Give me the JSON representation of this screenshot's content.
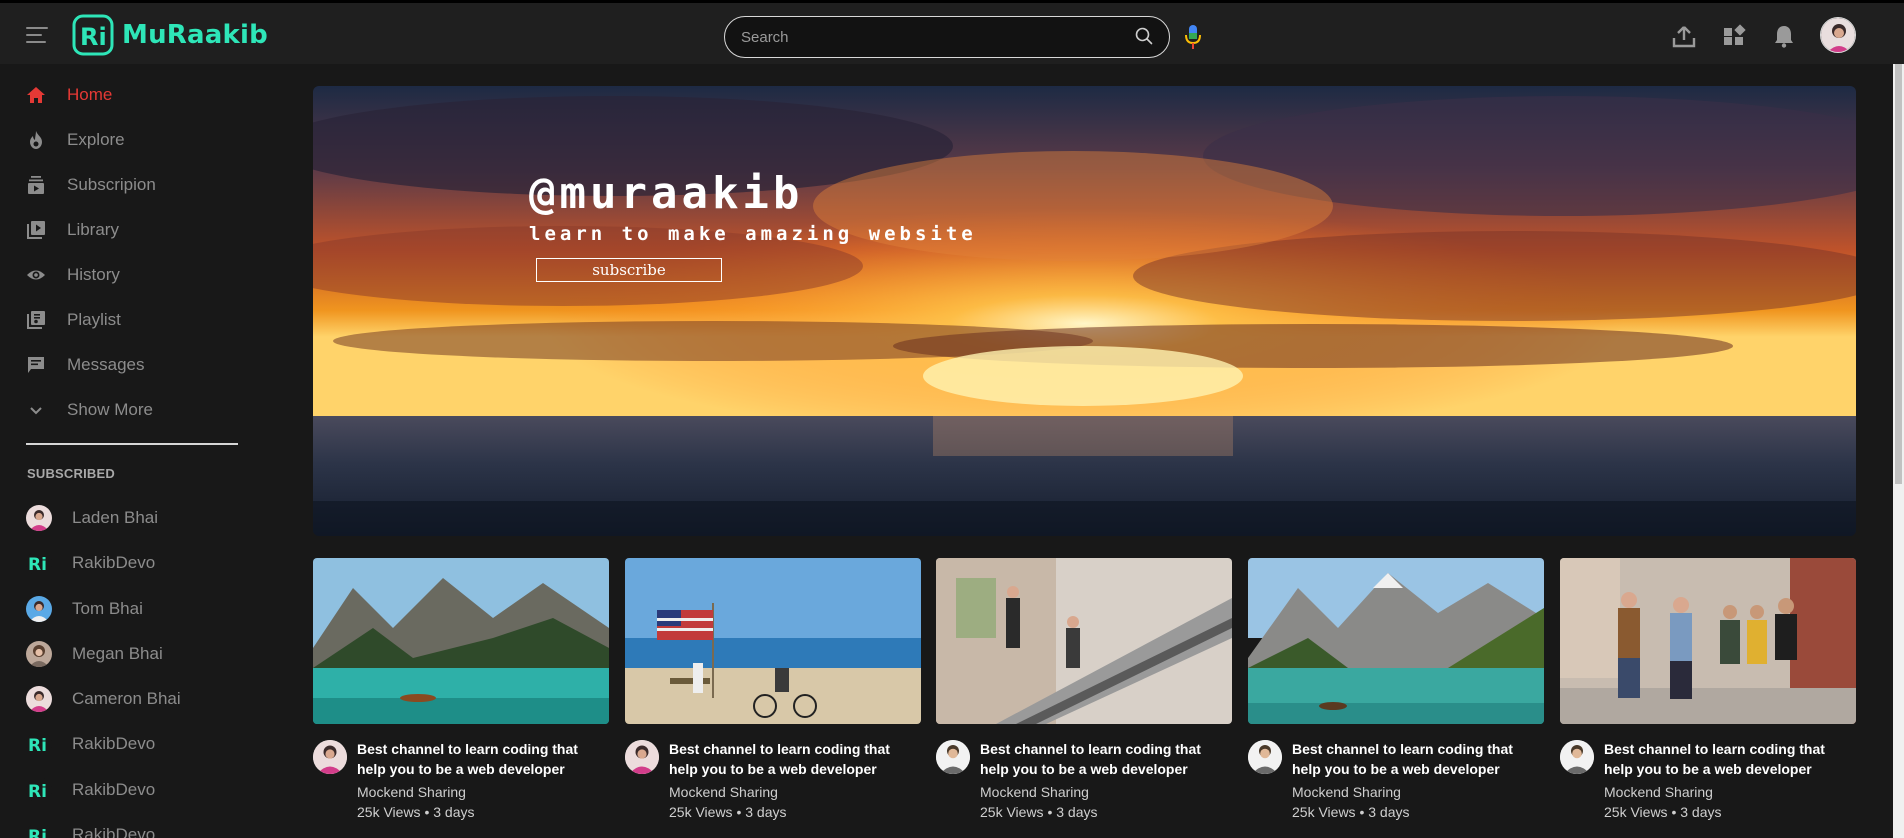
{
  "brand": {
    "name": "MuRaakib",
    "color": "#2ee6b8"
  },
  "search": {
    "placeholder": "Search"
  },
  "sidebar": {
    "items": [
      {
        "label": "Home",
        "icon": "home-icon",
        "active": true
      },
      {
        "label": "Explore",
        "icon": "flame-icon"
      },
      {
        "label": "Subscripion",
        "icon": "subscriptions-icon"
      },
      {
        "label": "Library",
        "icon": "library-icon"
      },
      {
        "label": "History",
        "icon": "eye-icon"
      },
      {
        "label": "Playlist",
        "icon": "playlist-icon"
      },
      {
        "label": "Messages",
        "icon": "chat-icon"
      },
      {
        "label": "Show More",
        "icon": "chevron-down-icon"
      }
    ],
    "subscribed_title": "SUBSCRIBED",
    "subscriptions": [
      {
        "name": "Laden Bhai"
      },
      {
        "name": "RakibDevo"
      },
      {
        "name": "Tom Bhai"
      },
      {
        "name": "Megan Bhai"
      },
      {
        "name": "Cameron Bhai"
      },
      {
        "name": "RakibDevo"
      },
      {
        "name": "RakibDevo"
      },
      {
        "name": "RakibDevo"
      }
    ]
  },
  "banner": {
    "title": "@muraakib",
    "subtitle": "Learn to make amazing website",
    "button": "subscribe"
  },
  "videos": [
    {
      "title": "Best channel to learn coding that help you to be a web developer",
      "channel": "Mockend Sharing",
      "meta": "25k Views • 3 days"
    },
    {
      "title": "Best channel to learn coding that help you to be a web developer",
      "channel": "Mockend Sharing",
      "meta": "25k Views • 3 days"
    },
    {
      "title": "Best channel to learn coding that help you to be a web developer",
      "channel": "Mockend Sharing",
      "meta": "25k Views • 3 days"
    },
    {
      "title": "Best channel to learn coding that help you to be a web developer",
      "channel": "Mockend Sharing",
      "meta": "25k Views • 3 days"
    },
    {
      "title": "Best channel to learn coding that help you to be a web developer",
      "channel": "Mockend Sharing",
      "meta": "25k Views • 3 days"
    }
  ],
  "colors": {
    "accent": "#e53935",
    "background": "#181818",
    "topbar": "#1f1f1f"
  }
}
